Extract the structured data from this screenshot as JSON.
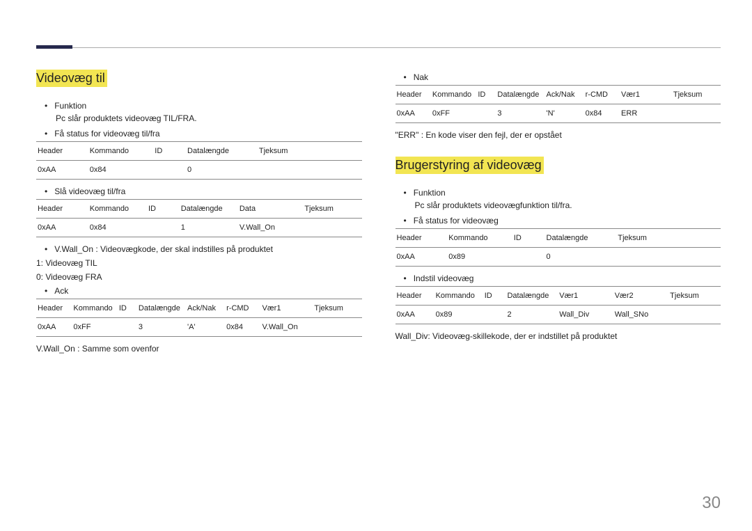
{
  "page_number": "30",
  "left": {
    "heading": "Videovæg til",
    "func_label": "Funktion",
    "func_desc": "Pc slår produktets videovæg TIL/FRA.",
    "status_label": "Få status for videovæg til/fra",
    "table1": {
      "h": [
        "Header",
        "Kommando",
        "ID",
        "Datalængde",
        "Tjeksum"
      ],
      "r": [
        "0xAA",
        "0x84",
        "",
        "0",
        ""
      ]
    },
    "set_label": "Slå videovæg til/fra",
    "table2": {
      "h": [
        "Header",
        "Kommando",
        "ID",
        "Datalængde",
        "Data",
        "Tjeksum"
      ],
      "r": [
        "0xAA",
        "0x84",
        "",
        "1",
        "V.Wall_On",
        ""
      ]
    },
    "vwall_note": "V.Wall_On : Videovægkode, der skal indstilles på produktet",
    "legend1": "1: Videovæg TIL",
    "legend0": "0: Videovæg FRA",
    "ack_label": "Ack",
    "table3": {
      "h": [
        "Header",
        "Kommando",
        "ID",
        "Datalængde",
        "Ack/Nak",
        "r-CMD",
        "Vær1",
        "Tjeksum"
      ],
      "r": [
        "0xAA",
        "0xFF",
        "",
        "3",
        "'A'",
        "0x84",
        "V.Wall_On",
        ""
      ]
    },
    "same_note": "V.Wall_On : Samme som ovenfor"
  },
  "right": {
    "nak_label": "Nak",
    "table4": {
      "h": [
        "Header",
        "Kommando",
        "ID",
        "Datalængde",
        "Ack/Nak",
        "r-CMD",
        "Vær1",
        "Tjeksum"
      ],
      "r": [
        "0xAA",
        "0xFF",
        "",
        "3",
        "'N'",
        "0x84",
        "ERR",
        ""
      ]
    },
    "err_note": "\"ERR\" : En kode viser den fejl, der er opstået",
    "heading": "Brugerstyring af videovæg",
    "func_label": "Funktion",
    "func_desc": "Pc slår produktets videovægfunktion til/fra.",
    "status_label": "Få status for videovæg",
    "table5": {
      "h": [
        "Header",
        "Kommando",
        "ID",
        "Datalængde",
        "Tjeksum"
      ],
      "r": [
        "0xAA",
        "0x89",
        "",
        "0",
        ""
      ]
    },
    "set_label": "Indstil videovæg",
    "table6": {
      "h": [
        "Header",
        "Kommando",
        "ID",
        "Datalængde",
        "Vær1",
        "Vær2",
        "Tjeksum"
      ],
      "r": [
        "0xAA",
        "0x89",
        "",
        "2",
        "Wall_Div",
        "Wall_SNo",
        ""
      ]
    },
    "walldiv_note": "Wall_Div: Videovæg-skillekode, der er indstillet på produktet"
  }
}
